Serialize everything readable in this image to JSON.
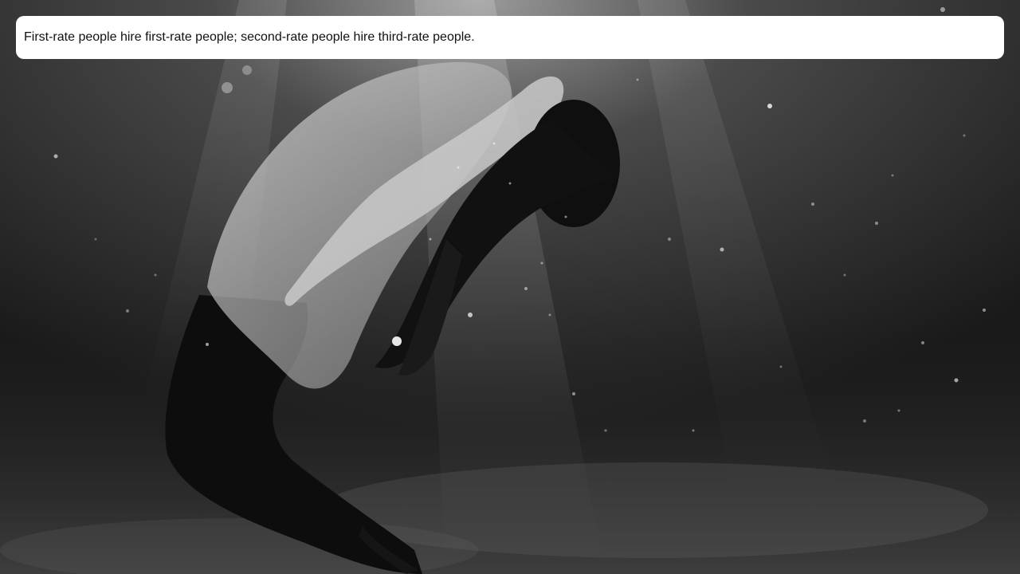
{
  "quote": {
    "text": "First-rate people hire first-rate people; second-rate people hire third-rate people."
  },
  "background": {
    "description_icon": "underwater-photo",
    "tone": "grayscale"
  },
  "colors": {
    "card_background": "#ffffff",
    "text": "#111111",
    "water_dark": "#161616",
    "water_light": "#8a8a8a"
  }
}
